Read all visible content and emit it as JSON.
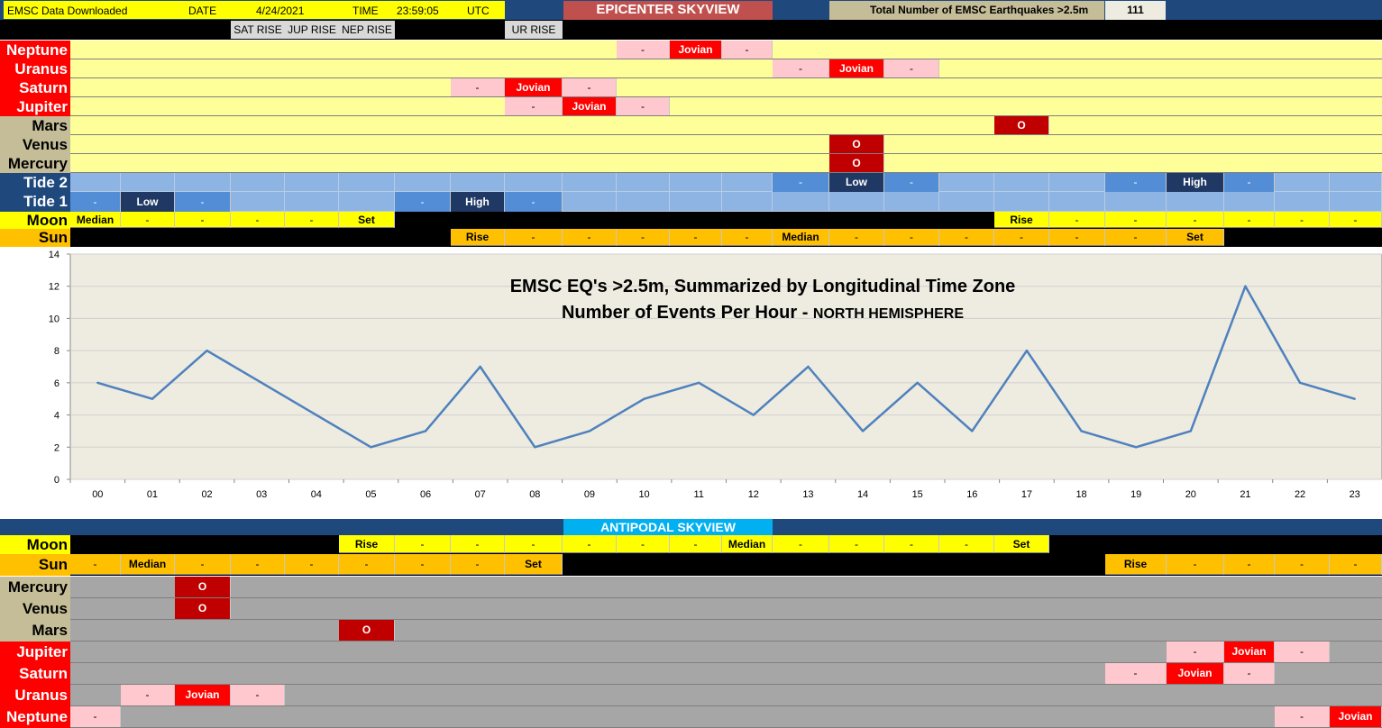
{
  "colors": {
    "yellow": "#ffff00",
    "pale_yellow": "#ffff99",
    "red": "#ff0000",
    "dark_red": "#c00000",
    "pink": "#ffc7ce",
    "khaki": "#c4bd97",
    "navy": "#1f497d",
    "tide_light": "#8db4e2",
    "tide_mid": "#538dd5",
    "tide_dark": "#1f3864",
    "orange": "#ffc000",
    "gray": "#a6a6a6",
    "cyan": "#00b0f0",
    "line": "#4f81bd",
    "plot_bg": "#eeece1"
  },
  "header": {
    "downloaded_label": "EMSC Data Downloaded",
    "date_label": "DATE",
    "date_value": "4/24/2021",
    "time_label": "TIME",
    "time_value": "23:59:05",
    "tz": "UTC",
    "epicenter_title": "EPICENTER SKYVIEW",
    "total_label": "Total Number of EMSC Earthquakes >2.5m",
    "total_value": "111",
    "sat_rise": "SAT RISE",
    "jup_rise": "JUP RISE",
    "nep_rise": "NEP RISE",
    "ur_rise": "UR RISE"
  },
  "epicenter_rows": [
    {
      "label": "Neptune",
      "label_style": "red",
      "fill": "pale_yellow",
      "cells": [
        {
          "i": 10,
          "t": "-",
          "s": "pink"
        },
        {
          "i": 11,
          "t": "Jovian",
          "s": "red"
        },
        {
          "i": 12,
          "t": "-",
          "s": "pink"
        }
      ]
    },
    {
      "label": "Uranus",
      "label_style": "red",
      "fill": "pale_yellow",
      "cells": [
        {
          "i": 13,
          "t": "-",
          "s": "pink"
        },
        {
          "i": 14,
          "t": "Jovian",
          "s": "red"
        },
        {
          "i": 15,
          "t": "-",
          "s": "pink"
        }
      ]
    },
    {
      "label": "Saturn",
      "label_style": "red",
      "fill": "pale_yellow",
      "cells": [
        {
          "i": 7,
          "t": "-",
          "s": "pink"
        },
        {
          "i": 8,
          "t": "Jovian",
          "s": "red"
        },
        {
          "i": 9,
          "t": "-",
          "s": "pink"
        }
      ]
    },
    {
      "label": "Jupiter",
      "label_style": "red",
      "fill": "pale_yellow",
      "cells": [
        {
          "i": 8,
          "t": "-",
          "s": "pink"
        },
        {
          "i": 9,
          "t": "Jovian",
          "s": "red"
        },
        {
          "i": 10,
          "t": "-",
          "s": "pink"
        }
      ]
    },
    {
      "label": "Mars",
      "label_style": "khaki",
      "fill": "pale_yellow",
      "cells": [
        {
          "i": 17,
          "t": "O",
          "s": "darkred"
        }
      ]
    },
    {
      "label": "Venus",
      "label_style": "khaki",
      "fill": "pale_yellow",
      "cells": [
        {
          "i": 14,
          "t": "O",
          "s": "darkred"
        }
      ]
    },
    {
      "label": "Mercury",
      "label_style": "khaki",
      "fill": "pale_yellow",
      "cells": [
        {
          "i": 14,
          "t": "O",
          "s": "darkred"
        }
      ]
    }
  ],
  "tide2": {
    "label": "Tide 2",
    "cells": [
      {
        "i": 13,
        "t": "-",
        "s": "mid"
      },
      {
        "i": 14,
        "t": "Low",
        "s": "dark"
      },
      {
        "i": 15,
        "t": "-",
        "s": "mid"
      },
      {
        "i": 19,
        "t": "-",
        "s": "mid"
      },
      {
        "i": 20,
        "t": "High",
        "s": "dark"
      },
      {
        "i": 21,
        "t": "-",
        "s": "mid"
      }
    ]
  },
  "tide1": {
    "label": "Tide 1",
    "cells": [
      {
        "i": 0,
        "t": "-",
        "s": "mid"
      },
      {
        "i": 1,
        "t": "Low",
        "s": "dark"
      },
      {
        "i": 2,
        "t": "-",
        "s": "mid"
      },
      {
        "i": 6,
        "t": "-",
        "s": "mid"
      },
      {
        "i": 7,
        "t": "High",
        "s": "dark"
      },
      {
        "i": 8,
        "t": "-",
        "s": "mid"
      }
    ]
  },
  "moon_epi": {
    "label": "Moon",
    "cells": [
      "Median",
      "-",
      "-",
      "-",
      "-",
      "Set",
      "",
      "",
      "",
      "",
      "",
      "",
      "",
      "",
      "",
      "",
      "",
      "Rise",
      "-",
      "-",
      "-",
      "-",
      "-",
      "-"
    ]
  },
  "sun_epi": {
    "label": "Sun",
    "cells": [
      "",
      "",
      "",
      "",
      "",
      "",
      "",
      "Rise",
      "-",
      "-",
      "-",
      "-",
      "-",
      "Median",
      "-",
      "-",
      "-",
      "-",
      "-",
      "-",
      "Set",
      "",
      "",
      ""
    ]
  },
  "chart_data": {
    "type": "line",
    "title": "EMSC EQ's >2.5m, Summarized by Longitudinal Time Zone",
    "subtitle_main": "Number of Events Per Hour - ",
    "subtitle_sub": "NORTH HEMISPHERE",
    "categories": [
      "00",
      "01",
      "02",
      "03",
      "04",
      "05",
      "06",
      "07",
      "08",
      "09",
      "10",
      "11",
      "12",
      "13",
      "14",
      "15",
      "16",
      "17",
      "18",
      "19",
      "20",
      "21",
      "22",
      "23"
    ],
    "values": [
      6,
      5,
      8,
      6,
      4,
      2,
      3,
      7,
      2,
      3,
      5,
      6,
      4,
      7,
      3,
      6,
      3,
      8,
      3,
      2,
      3,
      12,
      6,
      5
    ],
    "ylim": [
      0,
      14
    ],
    "yticks": [
      "0",
      "2",
      "4",
      "6",
      "8",
      "10",
      "12",
      "14"
    ],
    "grid": true
  },
  "antipodal_title": "ANTIPODAL SKYVIEW",
  "moon_anti": {
    "label": "Moon",
    "cells": [
      "",
      "",
      "",
      "",
      "",
      "Rise",
      "-",
      "-",
      "-",
      "-",
      "-",
      "-",
      "Median",
      "-",
      "-",
      "-",
      "-",
      "Set",
      "",
      "",
      "",
      "",
      "",
      ""
    ]
  },
  "sun_anti": {
    "label": "Sun",
    "cells": [
      "-",
      "Median",
      "-",
      "-",
      "-",
      "-",
      "-",
      "-",
      "Set",
      "",
      "",
      "",
      "",
      "",
      "",
      "",
      "",
      "",
      "",
      "Rise",
      "-",
      "-",
      "-",
      "-"
    ]
  },
  "antipodal_rows": [
    {
      "label": "Mercury",
      "label_style": "khaki",
      "cells": [
        {
          "i": 2,
          "t": "O",
          "s": "darkred"
        }
      ]
    },
    {
      "label": "Venus",
      "label_style": "khaki",
      "cells": [
        {
          "i": 2,
          "t": "O",
          "s": "darkred"
        }
      ]
    },
    {
      "label": "Mars",
      "label_style": "khaki",
      "cells": [
        {
          "i": 5,
          "t": "O",
          "s": "darkred"
        }
      ]
    },
    {
      "label": "Jupiter",
      "label_style": "red",
      "cells": [
        {
          "i": 20,
          "t": "-",
          "s": "pink"
        },
        {
          "i": 21,
          "t": "Jovian",
          "s": "red"
        },
        {
          "i": 22,
          "t": "-",
          "s": "pink"
        }
      ]
    },
    {
      "label": "Saturn",
      "label_style": "red",
      "cells": [
        {
          "i": 19,
          "t": "-",
          "s": "pink"
        },
        {
          "i": 20,
          "t": "Jovian",
          "s": "red"
        },
        {
          "i": 21,
          "t": "-",
          "s": "pink"
        }
      ]
    },
    {
      "label": "Uranus",
      "label_style": "red",
      "cells": [
        {
          "i": 1,
          "t": "-",
          "s": "pink"
        },
        {
          "i": 2,
          "t": "Jovian",
          "s": "red"
        },
        {
          "i": 3,
          "t": "-",
          "s": "pink"
        }
      ]
    },
    {
      "label": "Neptune",
      "label_style": "red",
      "cells": [
        {
          "i": 0,
          "t": "-",
          "s": "pink"
        },
        {
          "i": 22,
          "t": "-",
          "s": "pink"
        },
        {
          "i": 23,
          "t": "Jovian",
          "s": "red"
        }
      ]
    }
  ]
}
